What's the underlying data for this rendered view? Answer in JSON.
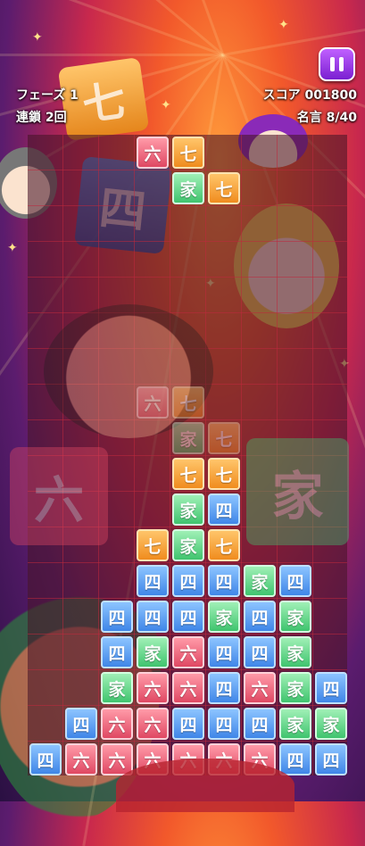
{
  "hud": {
    "phase": "フェーズ 1",
    "chain": "連鎖 2回",
    "score": "スコア 001800",
    "quotes": "名言 8/40"
  },
  "background_tiles": {
    "top_left": "七",
    "left_blue": "四",
    "bottom_left": "六",
    "bottom_right": "家"
  },
  "falling_piece": [
    {
      "row": 0,
      "col": 3,
      "char": "六",
      "color": "red"
    },
    {
      "row": 0,
      "col": 4,
      "char": "七",
      "color": "orange"
    },
    {
      "row": 1,
      "col": 4,
      "char": "家",
      "color": "green"
    },
    {
      "row": 1,
      "col": 5,
      "char": "七",
      "color": "orange"
    }
  ],
  "ghost_piece": [
    {
      "row": 7,
      "col": 3,
      "char": "六",
      "color": "red"
    },
    {
      "row": 7,
      "col": 4,
      "char": "七",
      "color": "orange"
    },
    {
      "row": 8,
      "col": 4,
      "char": "家",
      "color": "green"
    },
    {
      "row": 8,
      "col": 5,
      "char": "七",
      "color": "orange"
    }
  ],
  "board": [
    {
      "row": 9,
      "col": 4,
      "char": "七",
      "color": "orange"
    },
    {
      "row": 9,
      "col": 5,
      "char": "七",
      "color": "orange"
    },
    {
      "row": 10,
      "col": 4,
      "char": "家",
      "color": "green"
    },
    {
      "row": 10,
      "col": 5,
      "char": "四",
      "color": "blue"
    },
    {
      "row": 11,
      "col": 3,
      "char": "七",
      "color": "orange"
    },
    {
      "row": 11,
      "col": 4,
      "char": "家",
      "color": "green"
    },
    {
      "row": 11,
      "col": 5,
      "char": "七",
      "color": "orange"
    },
    {
      "row": 12,
      "col": 3,
      "char": "四",
      "color": "blue"
    },
    {
      "row": 12,
      "col": 4,
      "char": "四",
      "color": "blue"
    },
    {
      "row": 12,
      "col": 5,
      "char": "四",
      "color": "blue"
    },
    {
      "row": 12,
      "col": 6,
      "char": "家",
      "color": "green"
    },
    {
      "row": 12,
      "col": 7,
      "char": "四",
      "color": "blue"
    },
    {
      "row": 13,
      "col": 2,
      "char": "四",
      "color": "blue"
    },
    {
      "row": 13,
      "col": 3,
      "char": "四",
      "color": "blue"
    },
    {
      "row": 13,
      "col": 4,
      "char": "四",
      "color": "blue"
    },
    {
      "row": 13,
      "col": 5,
      "char": "家",
      "color": "green"
    },
    {
      "row": 13,
      "col": 6,
      "char": "四",
      "color": "blue"
    },
    {
      "row": 13,
      "col": 7,
      "char": "家",
      "color": "green"
    },
    {
      "row": 14,
      "col": 2,
      "char": "四",
      "color": "blue"
    },
    {
      "row": 14,
      "col": 3,
      "char": "家",
      "color": "green"
    },
    {
      "row": 14,
      "col": 4,
      "char": "六",
      "color": "red"
    },
    {
      "row": 14,
      "col": 5,
      "char": "四",
      "color": "blue"
    },
    {
      "row": 14,
      "col": 6,
      "char": "四",
      "color": "blue"
    },
    {
      "row": 14,
      "col": 7,
      "char": "家",
      "color": "green"
    },
    {
      "row": 15,
      "col": 2,
      "char": "家",
      "color": "green"
    },
    {
      "row": 15,
      "col": 3,
      "char": "六",
      "color": "red"
    },
    {
      "row": 15,
      "col": 4,
      "char": "六",
      "color": "red"
    },
    {
      "row": 15,
      "col": 5,
      "char": "四",
      "color": "blue"
    },
    {
      "row": 15,
      "col": 6,
      "char": "六",
      "color": "red"
    },
    {
      "row": 15,
      "col": 7,
      "char": "家",
      "color": "green"
    },
    {
      "row": 15,
      "col": 8,
      "char": "四",
      "color": "blue"
    },
    {
      "row": 16,
      "col": 1,
      "char": "四",
      "color": "blue"
    },
    {
      "row": 16,
      "col": 2,
      "char": "六",
      "color": "red"
    },
    {
      "row": 16,
      "col": 3,
      "char": "六",
      "color": "red"
    },
    {
      "row": 16,
      "col": 4,
      "char": "四",
      "color": "blue"
    },
    {
      "row": 16,
      "col": 5,
      "char": "四",
      "color": "blue"
    },
    {
      "row": 16,
      "col": 6,
      "char": "四",
      "color": "blue"
    },
    {
      "row": 16,
      "col": 7,
      "char": "家",
      "color": "green"
    },
    {
      "row": 16,
      "col": 8,
      "char": "家",
      "color": "green"
    },
    {
      "row": 17,
      "col": 0,
      "char": "四",
      "color": "blue"
    },
    {
      "row": 17,
      "col": 1,
      "char": "六",
      "color": "red"
    },
    {
      "row": 17,
      "col": 2,
      "char": "六",
      "color": "red"
    },
    {
      "row": 17,
      "col": 3,
      "char": "六",
      "color": "red"
    },
    {
      "row": 17,
      "col": 4,
      "char": "六",
      "color": "red"
    },
    {
      "row": 17,
      "col": 5,
      "char": "六",
      "color": "red"
    },
    {
      "row": 17,
      "col": 6,
      "char": "六",
      "color": "red"
    },
    {
      "row": 17,
      "col": 7,
      "char": "四",
      "color": "blue"
    },
    {
      "row": 17,
      "col": 8,
      "char": "四",
      "color": "blue"
    }
  ]
}
